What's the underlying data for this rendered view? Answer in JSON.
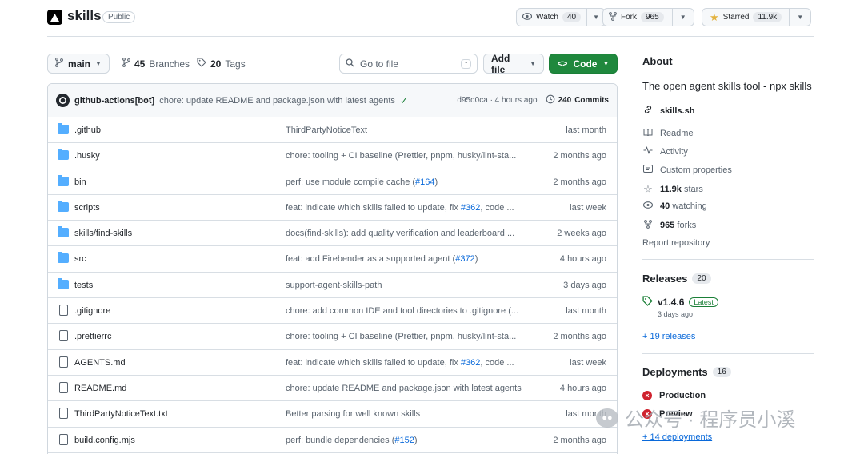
{
  "repo": {
    "name": "skills",
    "visibility": "Public"
  },
  "actions": {
    "watch": {
      "label": "Watch",
      "count": "40"
    },
    "fork": {
      "label": "Fork",
      "count": "965"
    },
    "star": {
      "label": "Starred",
      "count": "11.9k"
    }
  },
  "toolbar": {
    "branch": "main",
    "branches_count": "45",
    "branches_label": "Branches",
    "tags_count": "20",
    "tags_label": "Tags",
    "search_placeholder": "Go to file",
    "search_kbd": "t",
    "add_file": "Add file",
    "code": "Code"
  },
  "commit": {
    "author": "github-actions[bot]",
    "message": "chore: update README and package.json with latest agents",
    "hash": "d95d0ca",
    "time": "· 4 hours ago",
    "commits_count": "240",
    "commits_label": "Commits"
  },
  "files": [
    {
      "type": "dir",
      "name": ".github",
      "msg": "ThirdPartyNoticeText",
      "link": "",
      "msg_end": "",
      "date": "last month"
    },
    {
      "type": "dir",
      "name": ".husky",
      "msg": "chore: tooling + CI baseline (Prettier, pnpm, husky/lint-sta...",
      "link": "",
      "msg_end": "",
      "date": "2 months ago"
    },
    {
      "type": "dir",
      "name": "bin",
      "msg": "perf: use module compile cache (",
      "link": "#164",
      "msg_end": ")",
      "date": "2 months ago"
    },
    {
      "type": "dir",
      "name": "scripts",
      "msg": "feat: indicate which skills failed to update, fix ",
      "link": "#362",
      "msg_end": ", code ...",
      "date": "last week"
    },
    {
      "type": "dir",
      "name": "skills/find-skills",
      "msg": "docs(find-skills): add quality verification and leaderboard ...",
      "link": "",
      "msg_end": "",
      "date": "2 weeks ago"
    },
    {
      "type": "dir",
      "name": "src",
      "msg": "feat: add Firebender as a supported agent (",
      "link": "#372",
      "msg_end": ")",
      "date": "4 hours ago"
    },
    {
      "type": "dir",
      "name": "tests",
      "msg": "support-agent-skills-path",
      "link": "",
      "msg_end": "",
      "date": "3 days ago"
    },
    {
      "type": "file",
      "name": ".gitignore",
      "msg": "chore: add common IDE and tool directories to .gitignore (...",
      "link": "",
      "msg_end": "",
      "date": "last month"
    },
    {
      "type": "file",
      "name": ".prettierrc",
      "msg": "chore: tooling + CI baseline (Prettier, pnpm, husky/lint-sta...",
      "link": "",
      "msg_end": "",
      "date": "2 months ago"
    },
    {
      "type": "file",
      "name": "AGENTS.md",
      "msg": "feat: indicate which skills failed to update, fix ",
      "link": "#362",
      "msg_end": ", code ...",
      "date": "last week"
    },
    {
      "type": "file",
      "name": "README.md",
      "msg": "chore: update README and package.json with latest agents",
      "link": "",
      "msg_end": "",
      "date": "4 hours ago"
    },
    {
      "type": "file",
      "name": "ThirdPartyNoticeText.txt",
      "msg": "Better parsing for well known skills",
      "link": "",
      "msg_end": "",
      "date": "last month"
    },
    {
      "type": "file",
      "name": "build.config.mjs",
      "msg": "perf: bundle dependencies (",
      "link": "#152",
      "msg_end": ")",
      "date": "2 months ago"
    }
  ],
  "about": {
    "heading": "About",
    "description": "The open agent skills tool - npx skills",
    "website": "skills.sh",
    "readme": "Readme",
    "activity": "Activity",
    "custom_properties": "Custom properties",
    "stars_count": "11.9k",
    "stars_label": "stars",
    "watching_count": "40",
    "watching_label": "watching",
    "forks_count": "965",
    "forks_label": "forks",
    "report": "Report repository"
  },
  "releases": {
    "heading": "Releases",
    "count": "20",
    "latest_version": "v1.4.6",
    "latest_badge": "Latest",
    "latest_date": "3 days ago",
    "more": "+ 19 releases"
  },
  "deployments": {
    "heading": "Deployments",
    "count": "16",
    "items": [
      "Production",
      "Preview"
    ],
    "more": "+ 14 deployments"
  },
  "watermark": {
    "text": "公众号 · 程序员小溪"
  },
  "colors": {
    "accent": "#0969da",
    "code_button": "#1f883d",
    "folder": "#54aeff",
    "error": "#cf222e"
  }
}
